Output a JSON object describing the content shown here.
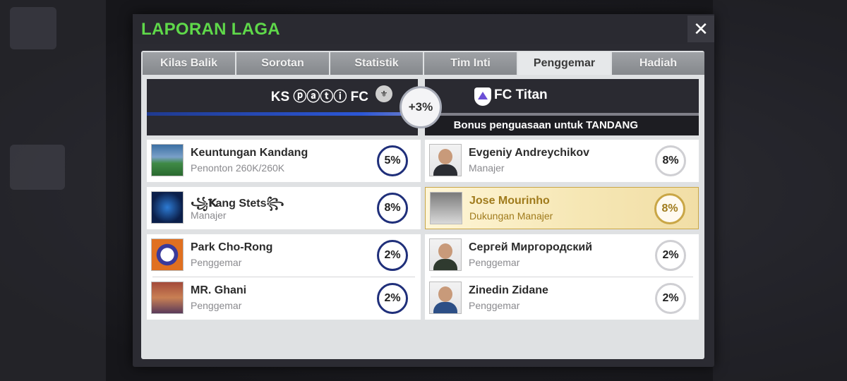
{
  "modal": {
    "title": "LAPORAN LAGA",
    "close_label": "✕"
  },
  "tabs": [
    {
      "label": "Kilas Balik"
    },
    {
      "label": "Sorotan"
    },
    {
      "label": "Statistik"
    },
    {
      "label": "Tim Inti"
    },
    {
      "label": "Penggemar",
      "active": true
    },
    {
      "label": "Hadiah"
    }
  ],
  "home_team": {
    "name": "KS ⓟⓐⓣⓘ FC",
    "crest": "shield-crest-icon"
  },
  "away_team": {
    "name": "FC Titan",
    "crest": "triangle-crest-icon"
  },
  "center_bonus": "+3%",
  "bonus_text": "Bonus penguasaan untuk TANDANG",
  "home_rows": [
    {
      "name": "Keuntungan Kandang",
      "sub": "Penonton 260K/260K",
      "pct": "5%"
    },
    {
      "name": "꧁Ꝁang Stets꧂",
      "sub": "Manajer",
      "pct": "8%"
    },
    {
      "name": "Park Cho-Rong",
      "sub": "Penggemar",
      "pct": "2%"
    },
    {
      "name": "MR. Ghani",
      "sub": "Penggemar",
      "pct": "2%"
    }
  ],
  "away_rows": [
    {
      "name": "Evgeniy Andreychikov",
      "sub": "Manajer",
      "pct": "8%"
    },
    {
      "name": "Jose Mourinho",
      "sub": "Dukungan Manajer",
      "pct": "8%"
    },
    {
      "name": "Сергей Миргородский",
      "sub": "Penggemar",
      "pct": "2%"
    },
    {
      "name": "Zinedin Zidane",
      "sub": "Penggemar",
      "pct": "2%"
    }
  ],
  "colors": {
    "title_green": "#5fd84a",
    "home_ring": "#1f2f7a",
    "gold": "#c9a646"
  }
}
